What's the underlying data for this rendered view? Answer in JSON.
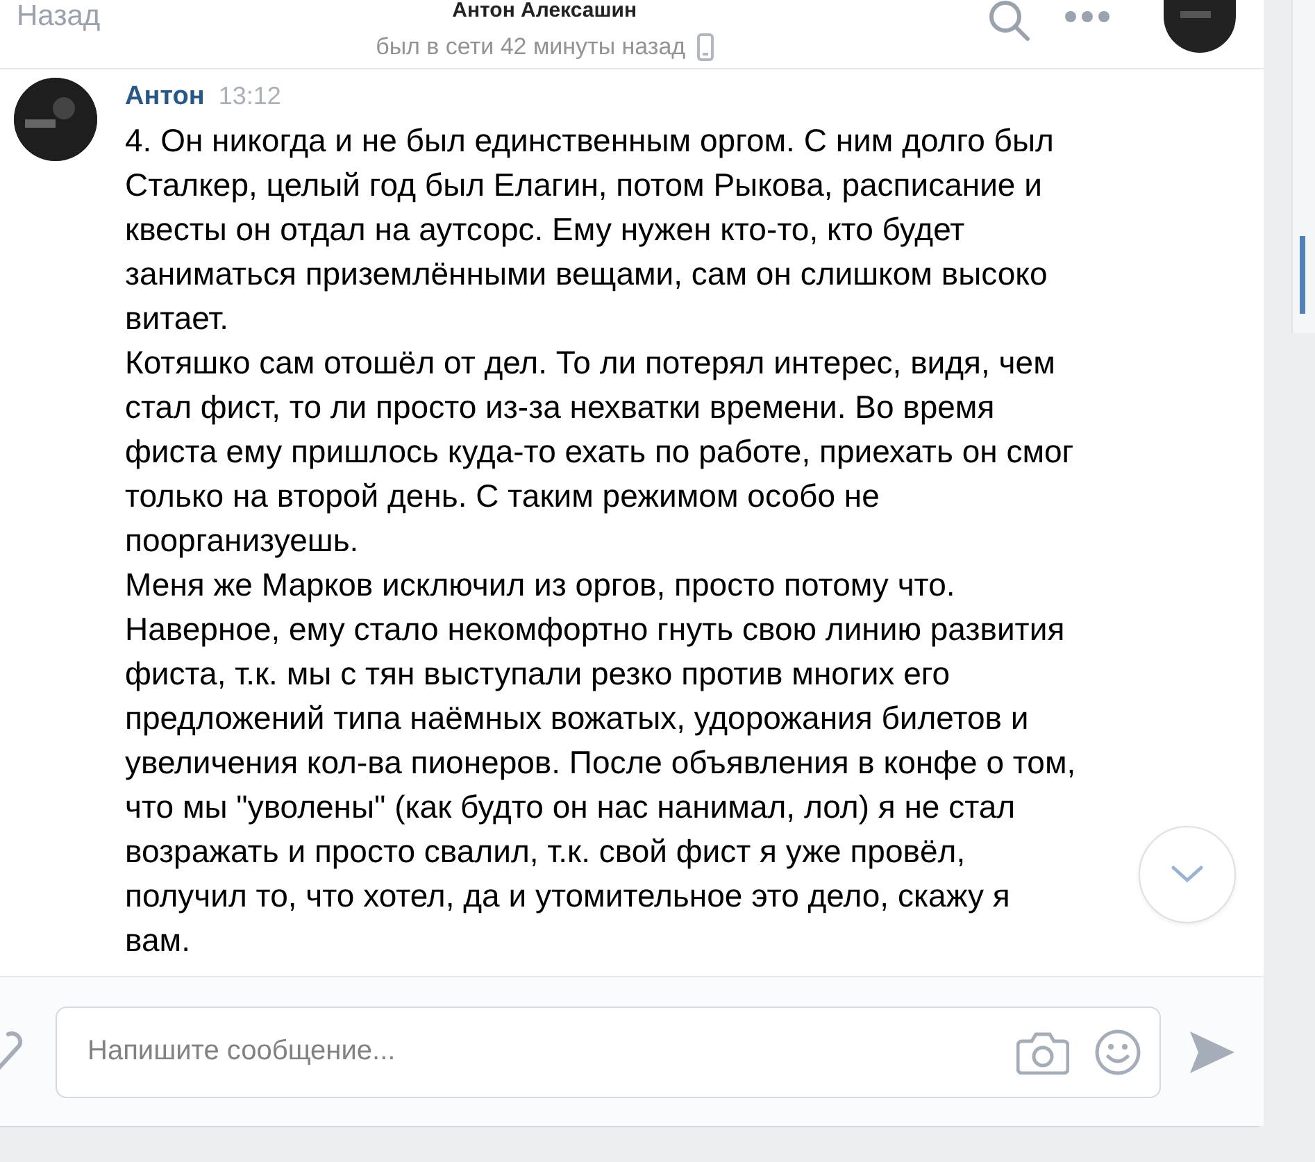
{
  "header": {
    "back": "Назад",
    "title": "Антон Алексашин",
    "status": "был в сети 42 минуты назад"
  },
  "messages": [
    {
      "author": "Антон",
      "time": "13:12",
      "paragraphs": [
        "4. Он никогда и не был единственным оргом. С ним долго был Сталкер, целый год был Елагин, потом Рыкова, расписание и квесты он отдал на аутсорс. Ему нужен кто-то, кто будет заниматься приземлёнными вещами, сам он слишком высоко витает.",
        "Котяшко сам отошёл от дел. То ли потерял интерес, видя, чем стал фист, то ли просто из-за нехватки времени. Во время фиста ему пришлось куда-то ехать по работе, приехать он смог только на второй день. С таким режимом особо не поорганизуешь.",
        "Меня же Марков исключил из оргов, просто потому что. Наверное, ему стало некомфортно гнуть свою линию развития фиста, т.к. мы с тян выступали резко против многих его предложений типа наёмных вожатых, удорожания билетов и увеличения кол-ва пионеров. После объявления в конфе о том, что мы \"уволены\" (как будто он нас нанимал, лол) я не стал возражать и просто свалил, т.к. свой фист я уже провёл, получил то, что хотел, да и утомительное это дело, скажу я вам."
      ]
    }
  ],
  "composer": {
    "placeholder": "Напишите сообщение..."
  }
}
